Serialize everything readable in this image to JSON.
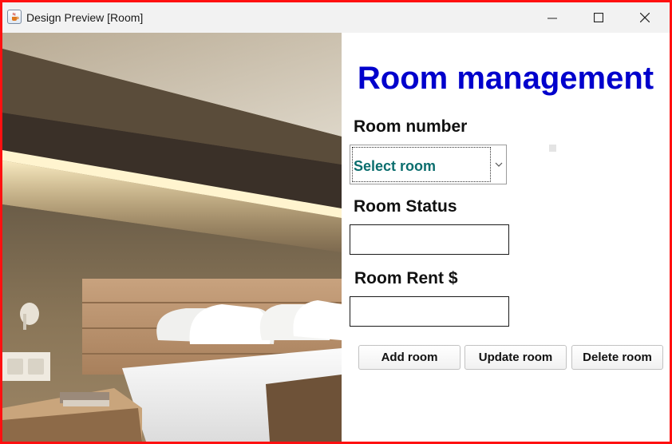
{
  "window": {
    "title": "Design Preview [Room]",
    "app_icon": "java-icon",
    "controls": [
      "minimize-icon",
      "maximize-icon",
      "close-icon"
    ]
  },
  "image": {
    "subject": "hotel-room-photo"
  },
  "form": {
    "heading": "Room management",
    "room_number": {
      "label": "Room number",
      "selected": "Select room"
    },
    "room_status": {
      "label": "Room Status",
      "value": ""
    },
    "room_rent": {
      "label": "Room Rent $",
      "value": ""
    }
  },
  "buttons": {
    "add": "Add room",
    "update": "Update room",
    "delete": "Delete room"
  },
  "colors": {
    "frame_border": "#ff1010",
    "heading": "#0000cc",
    "select_text": "#0b6e6e"
  }
}
